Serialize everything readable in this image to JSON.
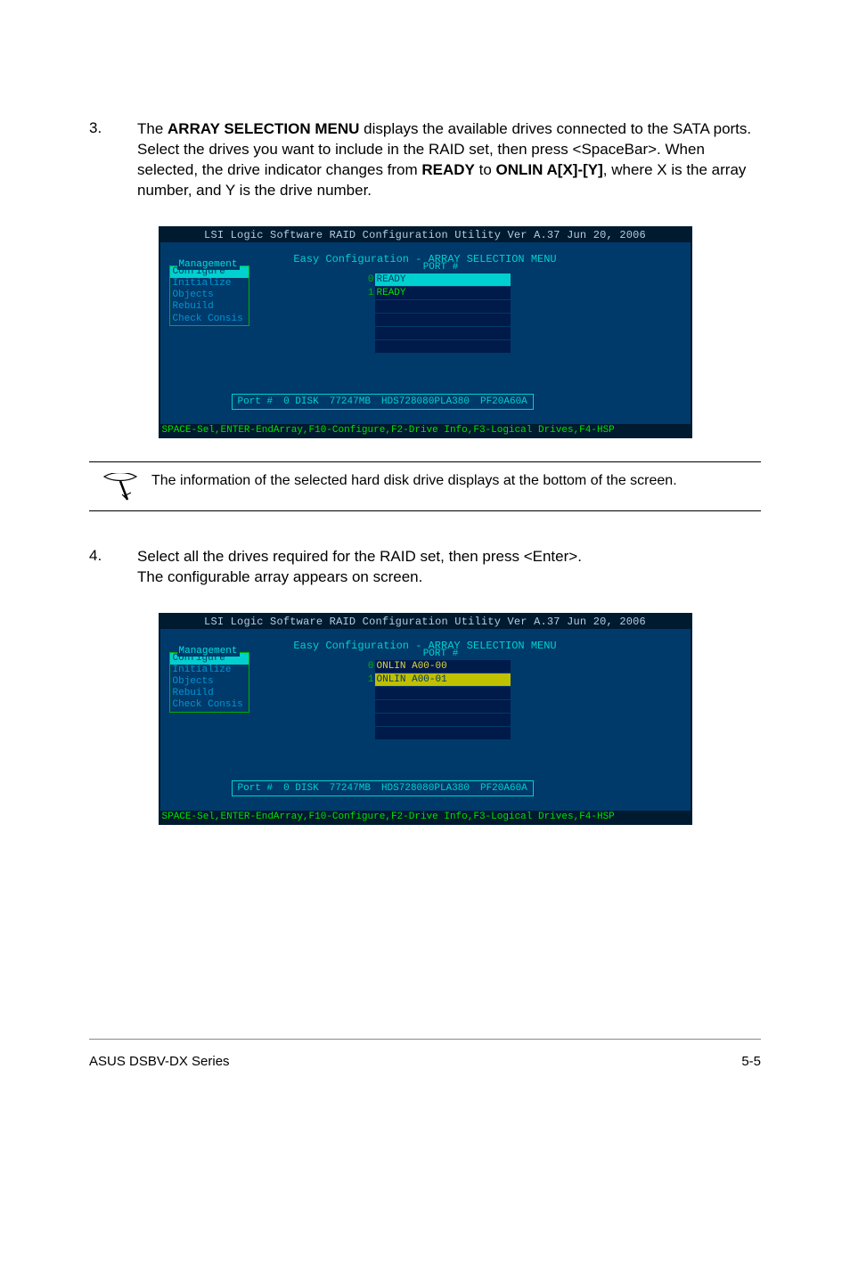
{
  "step3": {
    "num": "3.",
    "text_pre": "The ",
    "bold1": "ARRAY SELECTION MENU",
    "text_mid1": " displays the available drives connected to the SATA ports. Select the drives you want to include in the RAID set, then press <SpaceBar>. When selected, the drive indicator changes from ",
    "bold2": "READY",
    "text_mid2": " to ",
    "bold3": "ONLIN A[X]-[Y]",
    "text_end": ", where X is the array number, and Y is the drive number."
  },
  "term1": {
    "title": "LSI Logic Software RAID Configuration Utility Ver A.37 Jun 20, 2006",
    "easy": "Easy Configuration - ARRAY SELECTION MENU",
    "mgmt_label": "Management",
    "mgmt_items": [
      "Configure",
      "Initialize",
      "Objects",
      "Rebuild",
      "Check Consis"
    ],
    "port_header": "PORT #",
    "rows": [
      {
        "idx": "0",
        "label": "READY",
        "cls": "ready-sel"
      },
      {
        "idx": "1",
        "label": "READY",
        "cls": ""
      }
    ],
    "drive": {
      "port": "Port #",
      "disk": "0 DISK",
      "size": "77247MB",
      "model": "HDS728080PLA380",
      "fw": "PF20A60A"
    },
    "footer": "SPACE-Sel,ENTER-EndArray,F10-Configure,F2-Drive Info,F3-Logical Drives,F4-HSP"
  },
  "note": {
    "text": "The information of the selected hard disk drive displays at the bottom of the screen."
  },
  "step4": {
    "num": "4.",
    "line1": "Select all the drives required for the RAID set, then press <Enter>.",
    "line2": "The configurable array appears on screen."
  },
  "term2": {
    "title": "LSI Logic Software RAID Configuration Utility Ver A.37 Jun 20, 2006",
    "easy": "Easy Configuration - ARRAY SELECTION MENU",
    "mgmt_label": "Management",
    "mgmt_items": [
      "Configure",
      "Initialize",
      "Objects",
      "Rebuild",
      "Check Consis"
    ],
    "port_header": "PORT #",
    "rows": [
      {
        "idx": "0",
        "label": "ONLIN A00-00",
        "cls": "onlin"
      },
      {
        "idx": "1",
        "label": "ONLIN A00-01",
        "cls": "onlin-sel"
      }
    ],
    "drive": {
      "port": "Port #",
      "disk": "0 DISK",
      "size": "77247MB",
      "model": "HDS728080PLA380",
      "fw": "PF20A60A"
    },
    "footer": "SPACE-Sel,ENTER-EndArray,F10-Configure,F2-Drive Info,F3-Logical Drives,F4-HSP"
  },
  "footer": {
    "left": "ASUS DSBV-DX Series",
    "right": "5-5"
  }
}
